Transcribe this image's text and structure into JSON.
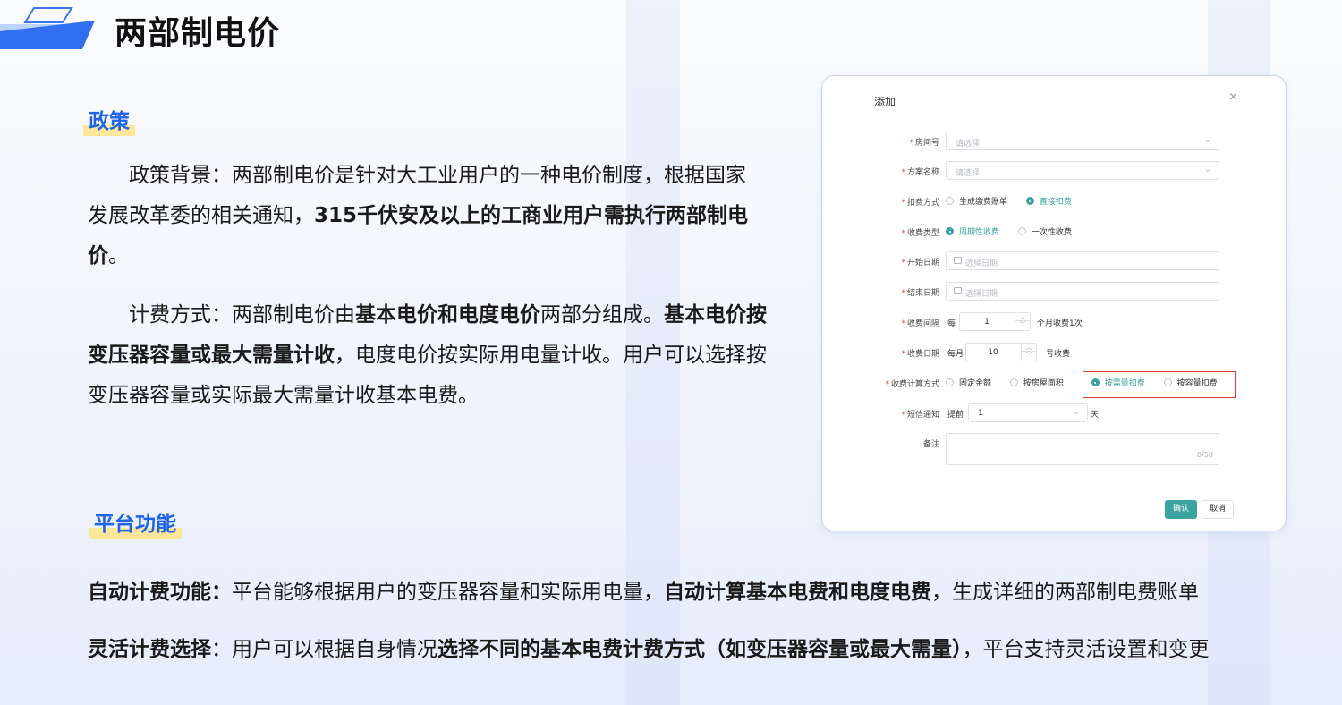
{
  "page": {
    "title": "两部制电价"
  },
  "policy": {
    "tag": "政策",
    "p1_lead": "政策背景：两部制电价是针对大工业用户的一种电价制度，根据国家发展改革委的相关通知，",
    "p1_bold": "315千伏安及以上的工商业用户需执行两部制电价",
    "p1_tail": "。",
    "p2_lead": "计费方式：两部制电价由",
    "p2_bold1": "基本电价和电度电价",
    "p2_mid": "两部分组成。",
    "p2_bold2": "基本电价按变压器容量或最大需量计收",
    "p2_tail": "，电度电价按实际用电量计收。用户可以选择按变压器容量或实际最大需量计收基本电费。"
  },
  "platform": {
    "tag": "平台功能",
    "f1_bold": "自动计费功能：",
    "f1_text": "平台能够根据用户的变压器容量和实际用电量，",
    "f1_bold2": "自动计算基本电费和电度电费",
    "f1_tail": "，生成详细的两部制电费账单",
    "f2_bold": "灵活计费选择",
    "f2_text": "：用户可以根据自身情况",
    "f2_bold2": "选择不同的基本电费计费方式（如变压器容量或最大需量）",
    "f2_tail": "，平台支持灵活设置和变更"
  },
  "dialog": {
    "title": "添加",
    "close": "×",
    "room": {
      "label": "房间号",
      "placeholder": "请选择"
    },
    "plan": {
      "label": "方案名称",
      "placeholder": "请选择"
    },
    "deduct": {
      "label": "扣费方式",
      "options": [
        "生成缴费账单",
        "直接扣费"
      ],
      "selected": 1
    },
    "charge_type": {
      "label": "收费类型",
      "options": [
        "周期性收费",
        "一次性收费"
      ],
      "selected": 0
    },
    "start_date": {
      "label": "开始日期",
      "placeholder": "选择日期"
    },
    "end_date": {
      "label": "结束日期",
      "placeholder": "选择日期"
    },
    "interval": {
      "label": "收费间隔",
      "prefix": "每",
      "value": "1",
      "suffix": "个月收费1次"
    },
    "day": {
      "label": "收费日期",
      "prefix": "每月",
      "value": "10",
      "suffix": "号收费"
    },
    "calc": {
      "label": "收费计算方式",
      "options": [
        "固定金额",
        "按房屋面积",
        "按需量扣费",
        "按容量扣费"
      ],
      "selected": 2
    },
    "sms": {
      "label": "短信通知",
      "prefix": "提前",
      "value": "1",
      "suffix": "天"
    },
    "remark": {
      "label": "备注",
      "counter": "0/50"
    },
    "confirm": "确认",
    "cancel": "取消"
  },
  "colors": {
    "accent": "#3aa3a0",
    "title_blue": "#1f64e6",
    "highlight": "#ffe79a",
    "red_box": "#e53935"
  }
}
